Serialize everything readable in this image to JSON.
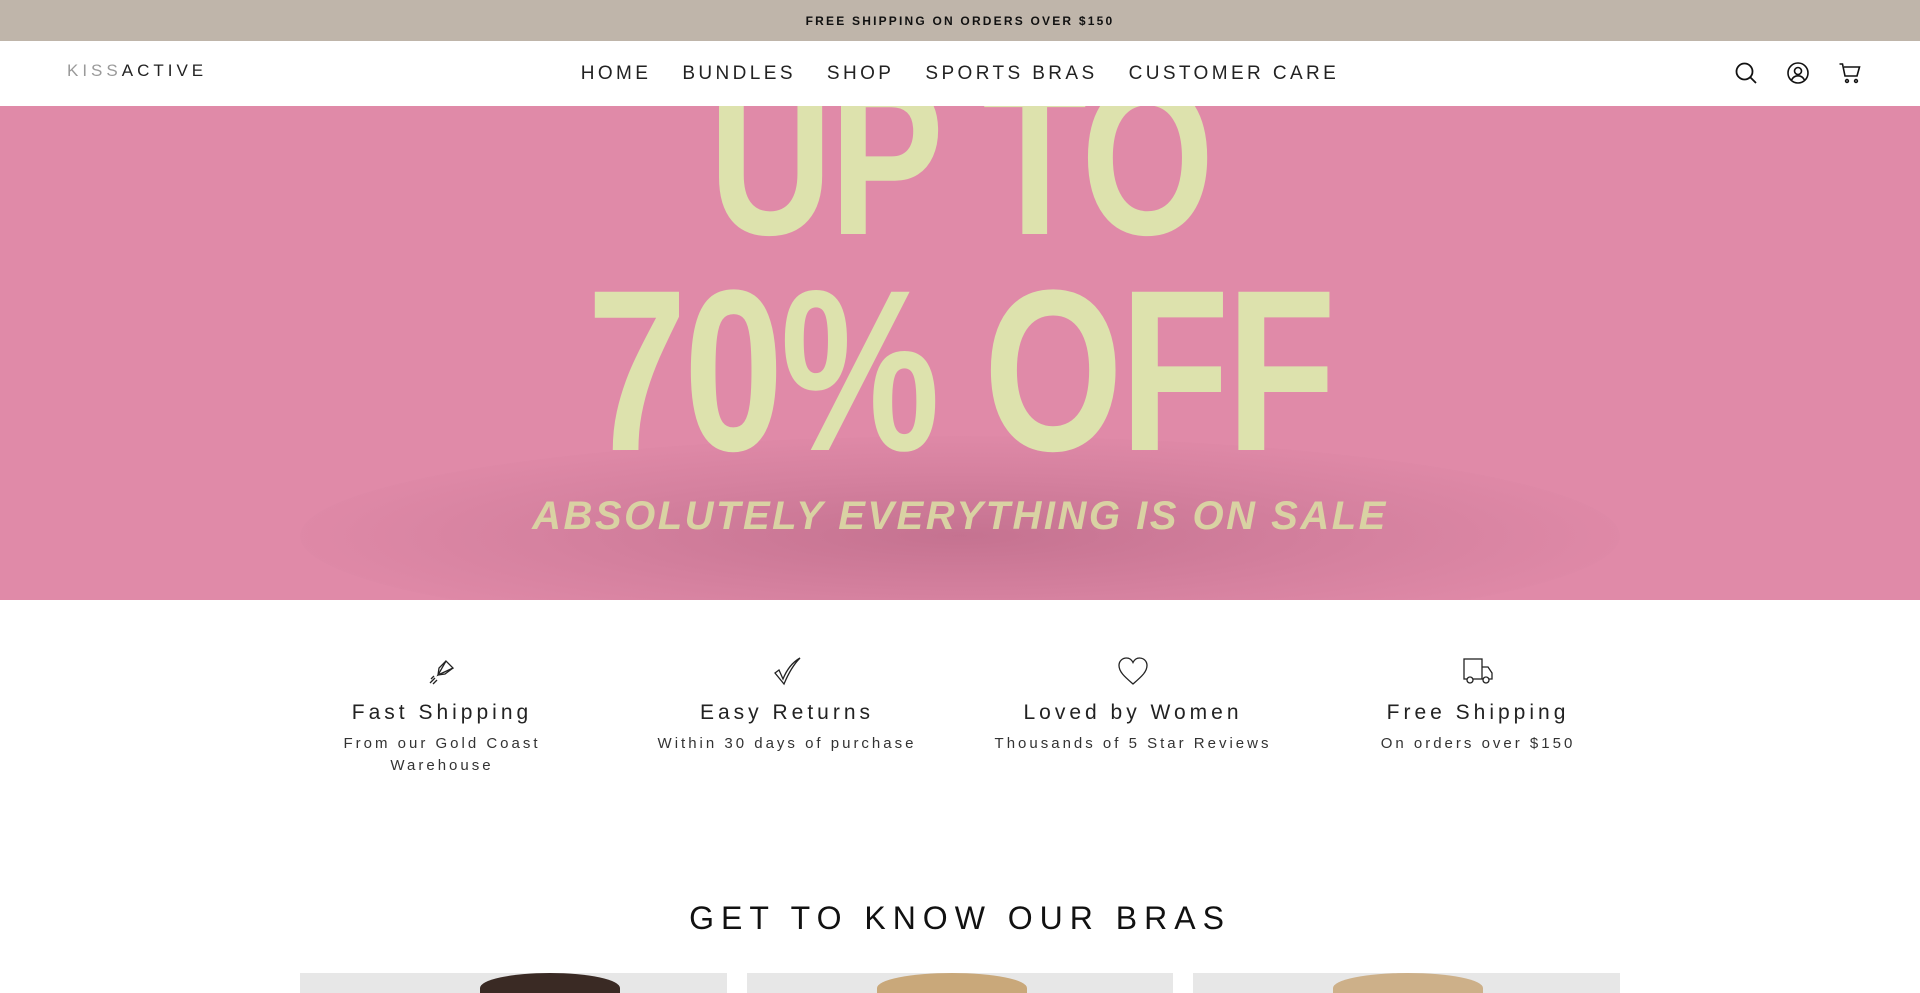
{
  "announcement": {
    "text": "FREE SHIPPING ON ORDERS OVER $150"
  },
  "header": {
    "logo_light": "KISS",
    "logo_dark": "ACTIVE",
    "nav": [
      {
        "label": "HOME"
      },
      {
        "label": "BUNDLES"
      },
      {
        "label": "SHOP"
      },
      {
        "label": "SPORTS BRAS"
      },
      {
        "label": "CUSTOMER CARE"
      }
    ],
    "icons": [
      "search-icon",
      "account-icon",
      "cart-icon"
    ]
  },
  "hero": {
    "line1": "UP TO",
    "line2": "70% OFF",
    "tagline": "ABSOLUTELY EVERYTHING IS ON SALE",
    "background_color": "#e08aa8",
    "text_color": "#dde2ad"
  },
  "features": [
    {
      "icon": "rocket-icon",
      "title": "Fast Shipping",
      "subtitle": "From our Gold Coast Warehouse"
    },
    {
      "icon": "checkmark-icon",
      "title": "Easy Returns",
      "subtitle": "Within 30 days of purchase"
    },
    {
      "icon": "heart-icon",
      "title": "Loved by Women",
      "subtitle": "Thousands of 5 Star Reviews"
    },
    {
      "icon": "truck-icon",
      "title": "Free Shipping",
      "subtitle": "On orders over $150"
    }
  ],
  "section": {
    "title": "GET TO KNOW OUR BRAS"
  },
  "colors": {
    "announcement_bg": "#bfb5aa",
    "hero_bg": "#e08aa8"
  }
}
